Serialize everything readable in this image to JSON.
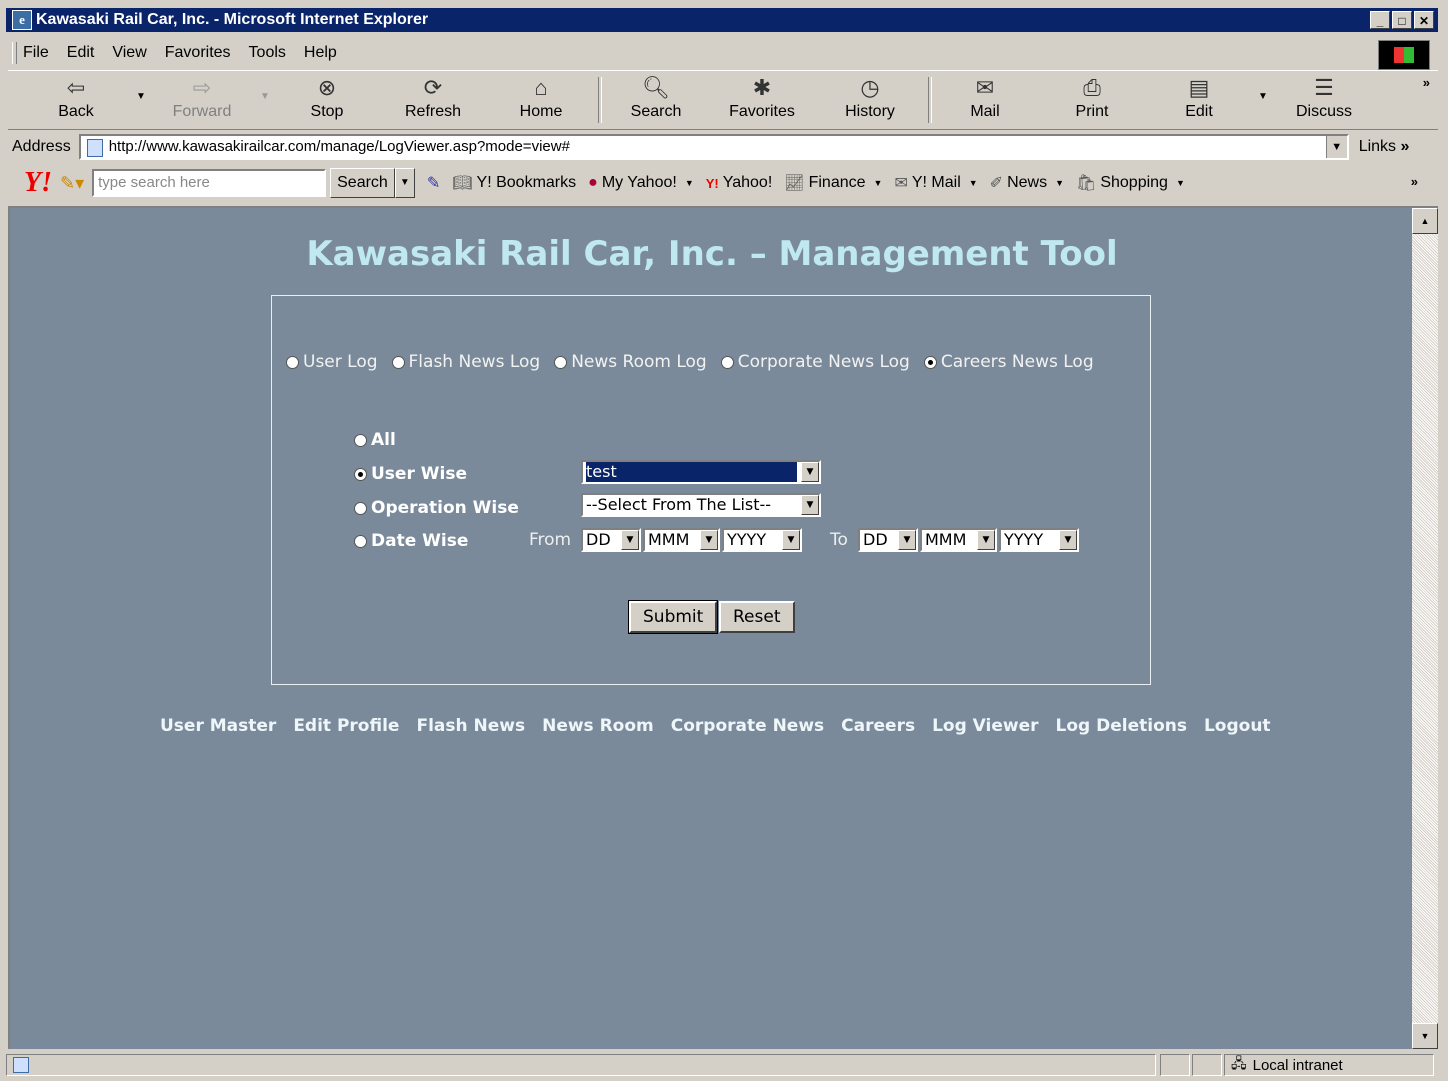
{
  "window": {
    "title": "Kawasaki Rail Car, Inc. - Microsoft Internet Explorer"
  },
  "menu": [
    "File",
    "Edit",
    "View",
    "Favorites",
    "Tools",
    "Help"
  ],
  "toolbar": {
    "back": "Back",
    "forward": "Forward",
    "stop": "Stop",
    "refresh": "Refresh",
    "home": "Home",
    "search": "Search",
    "favorites": "Favorites",
    "history": "History",
    "mail": "Mail",
    "print": "Print",
    "edit": "Edit",
    "discuss": "Discuss"
  },
  "address": {
    "label": "Address",
    "url": "http://www.kawasakirailcar.com/manage/LogViewer.asp?mode=view#",
    "links": "Links"
  },
  "yahoo": {
    "search_placeholder": "type search here",
    "search_button": "Search",
    "items": [
      "Y! Bookmarks",
      "My Yahoo!",
      "Yahoo!",
      "Finance",
      "Y! Mail",
      "News",
      "Shopping"
    ]
  },
  "page": {
    "title": "Kawasaki Rail Car, Inc. – Management Tool",
    "log_types": [
      {
        "label": "User Log",
        "checked": false
      },
      {
        "label": "Flash News Log",
        "checked": false
      },
      {
        "label": "News Room Log",
        "checked": false
      },
      {
        "label": "Corporate News Log",
        "checked": false
      },
      {
        "label": "Careers News Log",
        "checked": true
      }
    ],
    "filters": {
      "all": "All",
      "user_wise": "User Wise",
      "operation_wise": "Operation Wise",
      "date_wise": "Date Wise",
      "user_value": "test",
      "operation_value": "--Select From The List--",
      "from_label": "From",
      "to_label": "To",
      "day": "DD",
      "month": "MMM",
      "year": "YYYY",
      "selected": "user_wise"
    },
    "submit": "Submit",
    "reset": "Reset",
    "nav": [
      "User Master",
      "Edit Profile",
      "Flash News",
      "News Room",
      "Corporate News",
      "Careers",
      "Log Viewer",
      "Log Deletions",
      "Logout"
    ]
  },
  "status": {
    "zone": "Local intranet"
  },
  "colors": {
    "background": "#7a8a9a",
    "title": "#bfe8f0",
    "titlebar": "#0a246a"
  }
}
